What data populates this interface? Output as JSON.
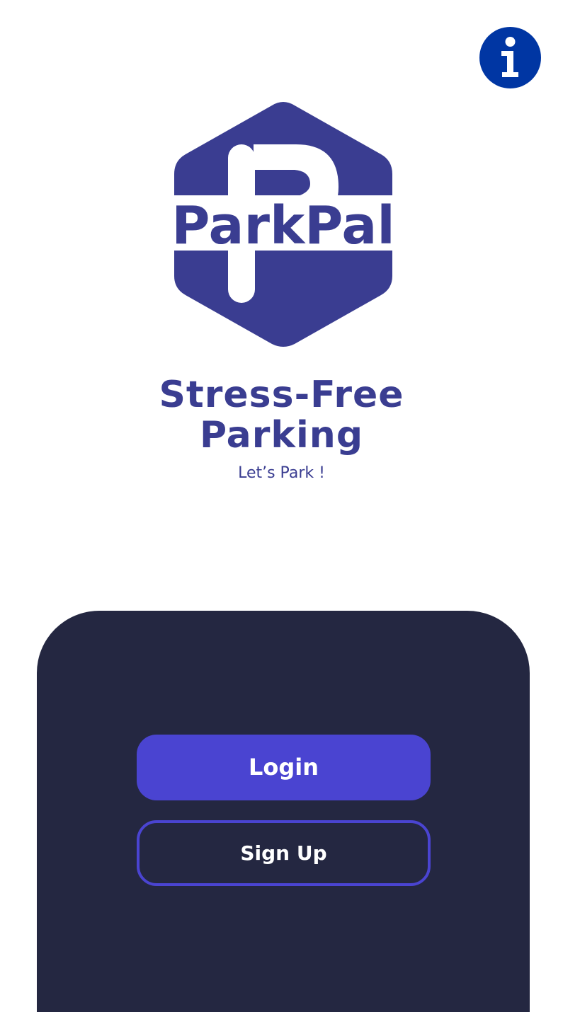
{
  "app": {
    "logo_text": "ParkPal",
    "brand_color": "#3a3d91"
  },
  "header": {
    "info_icon": "info-icon",
    "info_color": "#0036a3"
  },
  "hero": {
    "headline_line1": "Stress-Free",
    "headline_line2": "Parking",
    "tagline": "Let’s Park !"
  },
  "actions": {
    "login_label": "Login",
    "signup_label": "Sign Up",
    "accent_color": "#4a44d1",
    "panel_color": "#242741"
  }
}
